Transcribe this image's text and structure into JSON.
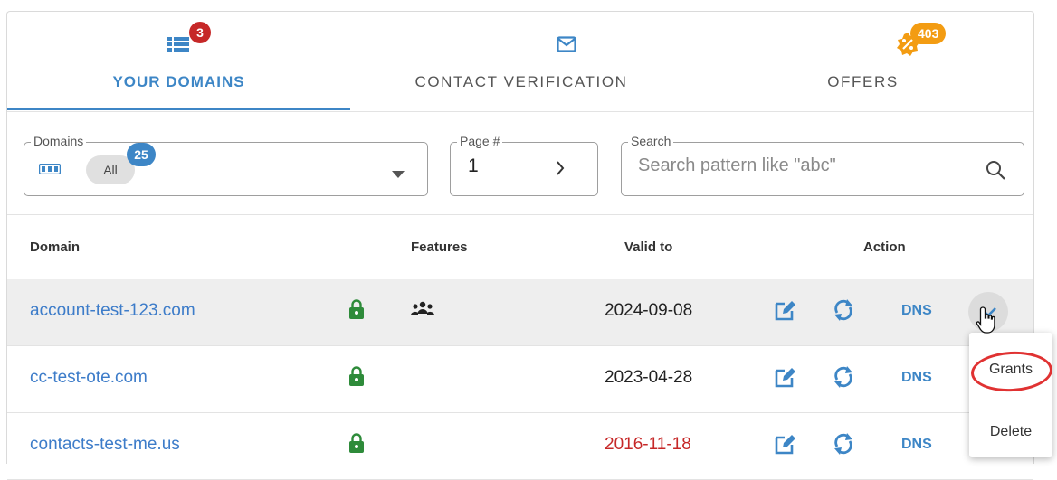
{
  "tabs": {
    "domains": {
      "label": "YOUR DOMAINS",
      "badge": "3",
      "icon": "list-icon"
    },
    "contact": {
      "label": "CONTACT VERIFICATION",
      "icon": "mail-icon"
    },
    "offers": {
      "label": "OFFERS",
      "badge": "403",
      "icon": "discount-badge-icon"
    }
  },
  "filters": {
    "domains": {
      "legend": "Domains",
      "chip": "All",
      "count": "25"
    },
    "page": {
      "legend": "Page #",
      "value": "1"
    },
    "search": {
      "legend": "Search",
      "placeholder": "Search pattern like \"abc\""
    }
  },
  "table": {
    "headers": {
      "domain": "Domain",
      "features": "Features",
      "valid_to": "Valid to",
      "action": "Action"
    },
    "rows": [
      {
        "domain": "account-test-123.com",
        "valid_to": "2024-09-08",
        "dns": "DNS",
        "has_group_feature": true,
        "highlighted": true
      },
      {
        "domain": "cc-test-ote.com",
        "valid_to": "2023-04-28",
        "dns": "DNS",
        "has_group_feature": false
      },
      {
        "domain": "contacts-test-me.us",
        "valid_to": "2016-11-18",
        "dns": "DNS",
        "has_group_feature": false,
        "expired": true
      }
    ]
  },
  "menu": {
    "items": [
      "Grants",
      "Delete"
    ]
  },
  "colors": {
    "accent": "#3d86c6",
    "lock": "#2e8b3a",
    "expired": "#c62828",
    "badge_red": "#c62828",
    "badge_orange": "#f39c12",
    "highlight_ring": "#e03232"
  }
}
